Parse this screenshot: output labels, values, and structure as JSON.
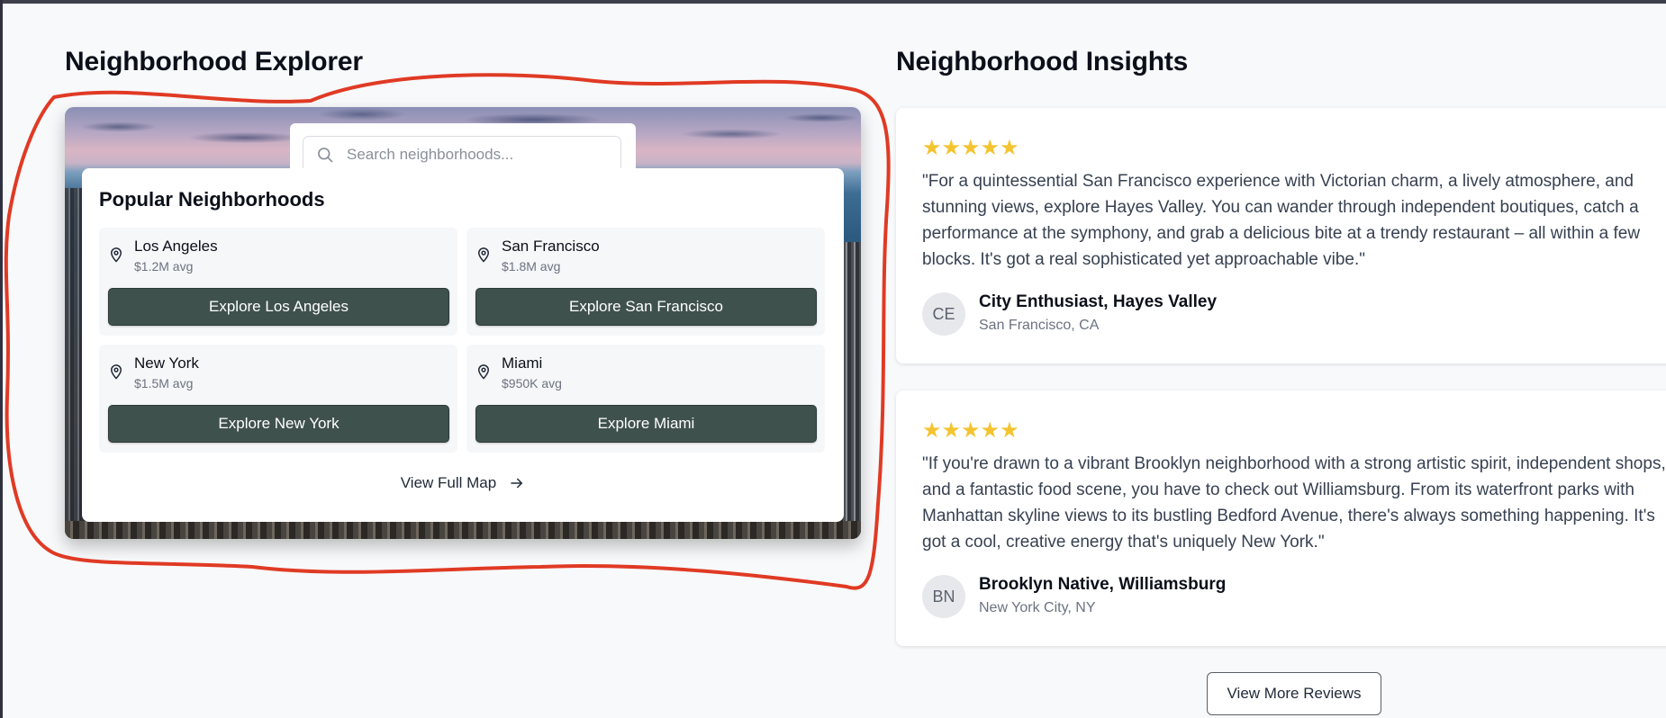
{
  "explorer": {
    "title": "Neighborhood Explorer",
    "search": {
      "placeholder": "Search neighborhoods...",
      "value": ""
    },
    "popular_title": "Popular Neighborhoods",
    "neighborhoods": [
      {
        "name": "Los Angeles",
        "price": "$1.2M avg",
        "button": "Explore Los Angeles"
      },
      {
        "name": "San Francisco",
        "price": "$1.8M avg",
        "button": "Explore San Francisco"
      },
      {
        "name": "New York",
        "price": "$1.5M avg",
        "button": "Explore New York"
      },
      {
        "name": "Miami",
        "price": "$950K avg",
        "button": "Explore Miami"
      }
    ],
    "view_map_label": "View Full Map"
  },
  "insights": {
    "title": "Neighborhood Insights",
    "reviews": [
      {
        "stars": "★★★★★",
        "quote": "\"For a quintessential San Francisco experience with Victorian charm, a lively atmosphere, and stunning views, explore Hayes Valley. You can wander through independent boutiques, catch a performance at the symphony, and grab a delicious bite at a trendy restaurant – all within a few blocks. It's got a real sophisticated yet approachable vibe.\"",
        "initials": "CE",
        "author": "City Enthusiast, Hayes Valley",
        "location": "San Francisco, CA"
      },
      {
        "stars": "★★★★★",
        "quote": "\"If you're drawn to a vibrant Brooklyn neighborhood with a strong artistic spirit, independent shops, and a fantastic food scene, you have to check out Williamsburg. From its waterfront parks with Manhattan skyline views to its bustling Bedford Avenue, there's always something happening. It's got a cool, creative energy that's uniquely New York.\"",
        "initials": "BN",
        "author": "Brooklyn Native, Williamsburg",
        "location": "New York City, NY"
      }
    ],
    "more_label": "View More Reviews"
  },
  "colors": {
    "button_bg": "#3f514d",
    "star": "#f4c430",
    "annotation": "#e03a24"
  },
  "icons": {
    "search": "search-icon",
    "pin": "map-pin-icon",
    "arrow": "arrow-right-icon"
  }
}
